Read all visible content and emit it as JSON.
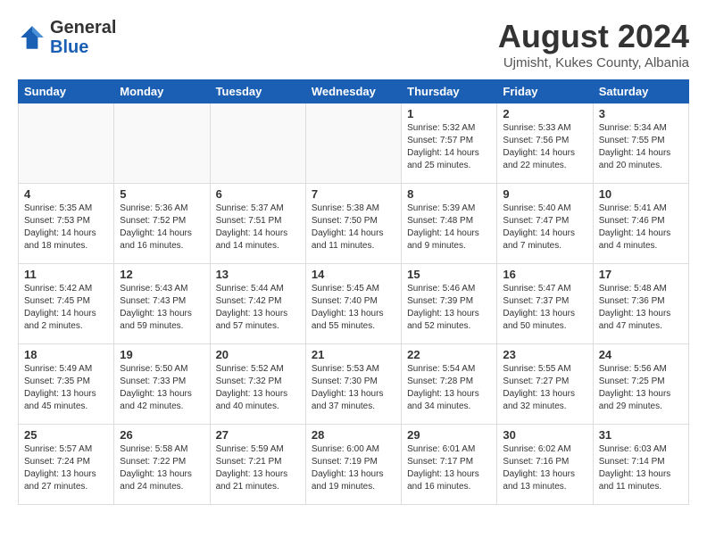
{
  "header": {
    "logo_line1": "General",
    "logo_line2": "Blue",
    "month_title": "August 2024",
    "location": "Ujmisht, Kukes County, Albania"
  },
  "days_of_week": [
    "Sunday",
    "Monday",
    "Tuesday",
    "Wednesday",
    "Thursday",
    "Friday",
    "Saturday"
  ],
  "weeks": [
    [
      {
        "day": "",
        "info": ""
      },
      {
        "day": "",
        "info": ""
      },
      {
        "day": "",
        "info": ""
      },
      {
        "day": "",
        "info": ""
      },
      {
        "day": "1",
        "info": "Sunrise: 5:32 AM\nSunset: 7:57 PM\nDaylight: 14 hours and 25 minutes."
      },
      {
        "day": "2",
        "info": "Sunrise: 5:33 AM\nSunset: 7:56 PM\nDaylight: 14 hours and 22 minutes."
      },
      {
        "day": "3",
        "info": "Sunrise: 5:34 AM\nSunset: 7:55 PM\nDaylight: 14 hours and 20 minutes."
      }
    ],
    [
      {
        "day": "4",
        "info": "Sunrise: 5:35 AM\nSunset: 7:53 PM\nDaylight: 14 hours and 18 minutes."
      },
      {
        "day": "5",
        "info": "Sunrise: 5:36 AM\nSunset: 7:52 PM\nDaylight: 14 hours and 16 minutes."
      },
      {
        "day": "6",
        "info": "Sunrise: 5:37 AM\nSunset: 7:51 PM\nDaylight: 14 hours and 14 minutes."
      },
      {
        "day": "7",
        "info": "Sunrise: 5:38 AM\nSunset: 7:50 PM\nDaylight: 14 hours and 11 minutes."
      },
      {
        "day": "8",
        "info": "Sunrise: 5:39 AM\nSunset: 7:48 PM\nDaylight: 14 hours and 9 minutes."
      },
      {
        "day": "9",
        "info": "Sunrise: 5:40 AM\nSunset: 7:47 PM\nDaylight: 14 hours and 7 minutes."
      },
      {
        "day": "10",
        "info": "Sunrise: 5:41 AM\nSunset: 7:46 PM\nDaylight: 14 hours and 4 minutes."
      }
    ],
    [
      {
        "day": "11",
        "info": "Sunrise: 5:42 AM\nSunset: 7:45 PM\nDaylight: 14 hours and 2 minutes."
      },
      {
        "day": "12",
        "info": "Sunrise: 5:43 AM\nSunset: 7:43 PM\nDaylight: 13 hours and 59 minutes."
      },
      {
        "day": "13",
        "info": "Sunrise: 5:44 AM\nSunset: 7:42 PM\nDaylight: 13 hours and 57 minutes."
      },
      {
        "day": "14",
        "info": "Sunrise: 5:45 AM\nSunset: 7:40 PM\nDaylight: 13 hours and 55 minutes."
      },
      {
        "day": "15",
        "info": "Sunrise: 5:46 AM\nSunset: 7:39 PM\nDaylight: 13 hours and 52 minutes."
      },
      {
        "day": "16",
        "info": "Sunrise: 5:47 AM\nSunset: 7:37 PM\nDaylight: 13 hours and 50 minutes."
      },
      {
        "day": "17",
        "info": "Sunrise: 5:48 AM\nSunset: 7:36 PM\nDaylight: 13 hours and 47 minutes."
      }
    ],
    [
      {
        "day": "18",
        "info": "Sunrise: 5:49 AM\nSunset: 7:35 PM\nDaylight: 13 hours and 45 minutes."
      },
      {
        "day": "19",
        "info": "Sunrise: 5:50 AM\nSunset: 7:33 PM\nDaylight: 13 hours and 42 minutes."
      },
      {
        "day": "20",
        "info": "Sunrise: 5:52 AM\nSunset: 7:32 PM\nDaylight: 13 hours and 40 minutes."
      },
      {
        "day": "21",
        "info": "Sunrise: 5:53 AM\nSunset: 7:30 PM\nDaylight: 13 hours and 37 minutes."
      },
      {
        "day": "22",
        "info": "Sunrise: 5:54 AM\nSunset: 7:28 PM\nDaylight: 13 hours and 34 minutes."
      },
      {
        "day": "23",
        "info": "Sunrise: 5:55 AM\nSunset: 7:27 PM\nDaylight: 13 hours and 32 minutes."
      },
      {
        "day": "24",
        "info": "Sunrise: 5:56 AM\nSunset: 7:25 PM\nDaylight: 13 hours and 29 minutes."
      }
    ],
    [
      {
        "day": "25",
        "info": "Sunrise: 5:57 AM\nSunset: 7:24 PM\nDaylight: 13 hours and 27 minutes."
      },
      {
        "day": "26",
        "info": "Sunrise: 5:58 AM\nSunset: 7:22 PM\nDaylight: 13 hours and 24 minutes."
      },
      {
        "day": "27",
        "info": "Sunrise: 5:59 AM\nSunset: 7:21 PM\nDaylight: 13 hours and 21 minutes."
      },
      {
        "day": "28",
        "info": "Sunrise: 6:00 AM\nSunset: 7:19 PM\nDaylight: 13 hours and 19 minutes."
      },
      {
        "day": "29",
        "info": "Sunrise: 6:01 AM\nSunset: 7:17 PM\nDaylight: 13 hours and 16 minutes."
      },
      {
        "day": "30",
        "info": "Sunrise: 6:02 AM\nSunset: 7:16 PM\nDaylight: 13 hours and 13 minutes."
      },
      {
        "day": "31",
        "info": "Sunrise: 6:03 AM\nSunset: 7:14 PM\nDaylight: 13 hours and 11 minutes."
      }
    ]
  ]
}
